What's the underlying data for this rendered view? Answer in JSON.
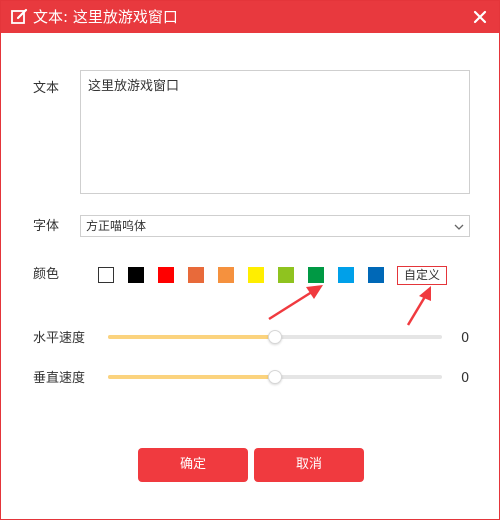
{
  "window": {
    "title": "文本: 这里放游戏窗口",
    "accent": "#e8393e"
  },
  "text_field": {
    "label": "文本",
    "value": "这里放游戏窗口"
  },
  "font_field": {
    "label": "字体",
    "selected": "方正喵呜体"
  },
  "color_field": {
    "label": "颜色",
    "swatches": [
      "#ffffff",
      "#000000",
      "#ff0000",
      "#e86a3a",
      "#f5913e",
      "#ffee00",
      "#8fc31f",
      "#009944",
      "#00a0e9",
      "#0068b7"
    ],
    "custom_label": "自定义"
  },
  "horizontal_speed": {
    "label": "水平速度",
    "value": "0",
    "level": 0.5
  },
  "vertical_speed": {
    "label": "垂直速度",
    "value": "0",
    "level": 0.5
  },
  "buttons": {
    "ok": "确定",
    "cancel": "取消"
  }
}
